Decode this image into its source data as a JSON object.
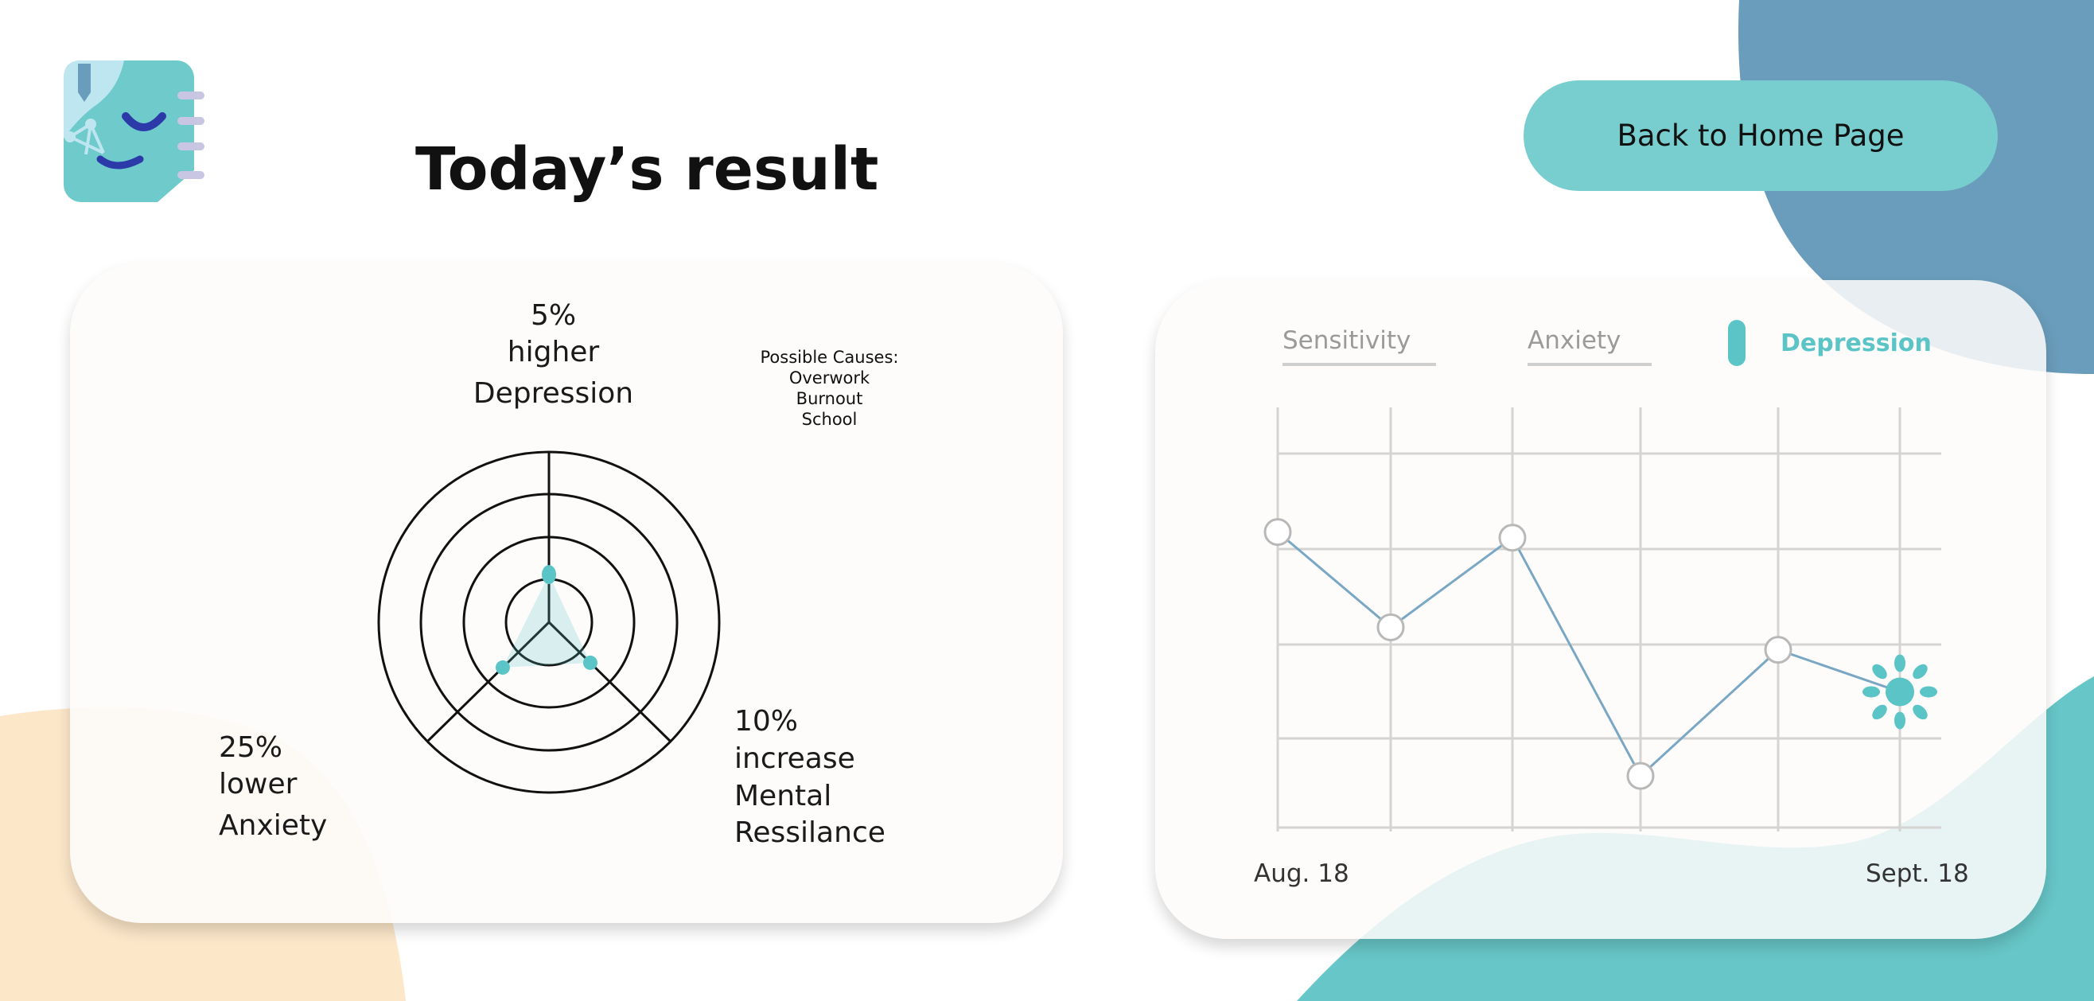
{
  "header": {
    "title": "Today’s result",
    "home_button_label": "Back to Home Page"
  },
  "radar": {
    "labels": {
      "depression": [
        "5%",
        "higher",
        "Depression"
      ],
      "anxiety": [
        "25%",
        "lower",
        "Anxiety"
      ],
      "resilience": [
        "10%",
        "increase",
        "Mental",
        "Ressilance"
      ]
    },
    "values": {
      "depression": 0.28,
      "resilience": 0.34,
      "anxiety": 0.38
    },
    "causes": [
      "Possible Causes:",
      "Overwork",
      "Burnout",
      "School"
    ]
  },
  "trend": {
    "tabs": [
      "Sensitivity",
      "Anxiety",
      "Depression"
    ],
    "active_tab": "Depression",
    "date_start": "Aug. 18",
    "date_end": "Sept. 18",
    "chart_data": {
      "type": "line",
      "x": [
        0,
        1,
        2,
        3,
        4,
        5
      ],
      "values": [
        0.72,
        0.38,
        0.7,
        -0.15,
        0.3,
        0.15
      ],
      "ylim": [
        -0.3,
        1.0
      ],
      "grid": true
    }
  },
  "colors": {
    "teal": "#5bc4c6",
    "teal_light": "#78cdce",
    "blue": "#6a9dbb",
    "peach": "#fde7c9",
    "line": "#7aa7c4"
  },
  "icons": {
    "logo": "notebook-face-icon",
    "highlight": "sun-icon"
  }
}
